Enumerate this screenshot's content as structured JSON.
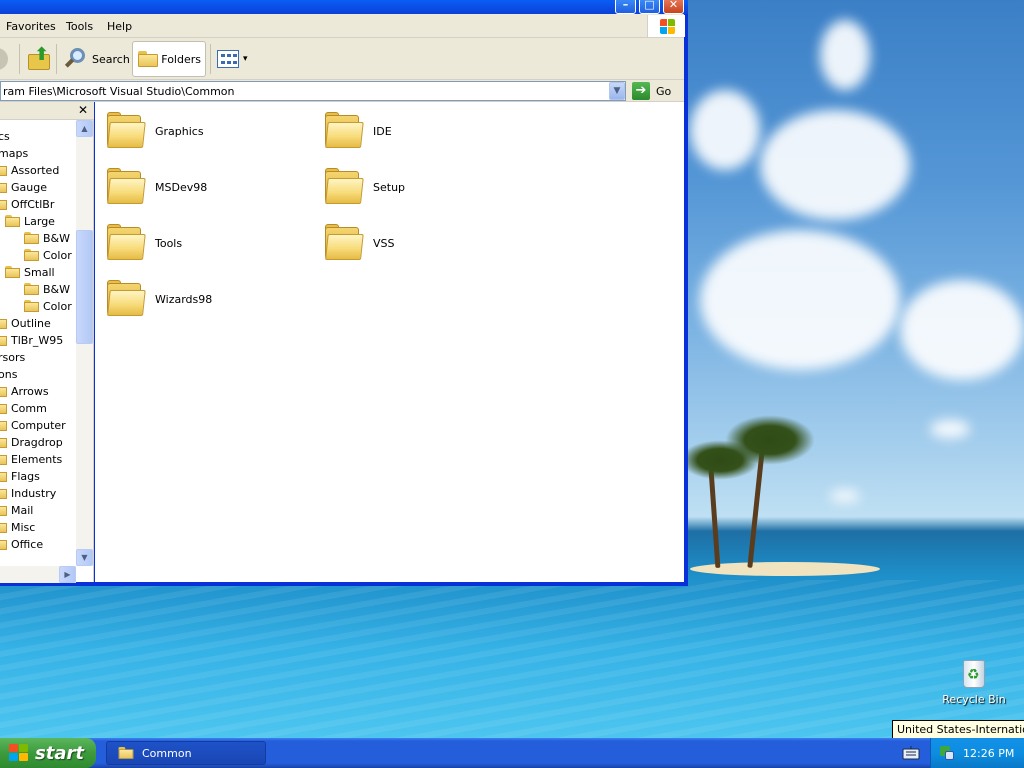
{
  "window": {
    "title_buttons": {
      "minimize": "–",
      "maximize": "□",
      "close": "✕"
    },
    "menu": [
      "Favorites",
      "Tools",
      "Help"
    ],
    "toolbar": {
      "up_label": "",
      "search_label": "Search",
      "folders_label": "Folders",
      "views_dropdown": "▾"
    },
    "address": {
      "value": "ram Files\\Microsoft Visual Studio\\Common",
      "go_label": "Go"
    },
    "folders_pane": {
      "close_label": "✕",
      "tree": [
        {
          "label": "cs",
          "folder": false
        },
        {
          "label": "maps",
          "folder": false
        },
        {
          "label": "Assorted",
          "folder": true
        },
        {
          "label": "Gauge",
          "folder": true
        },
        {
          "label": "OffCtlBr",
          "folder": true
        },
        {
          "label": "Large",
          "folder": true
        },
        {
          "label": "B&W",
          "folder": true
        },
        {
          "label": "Color",
          "folder": true
        },
        {
          "label": "Small",
          "folder": true
        },
        {
          "label": "B&W",
          "folder": true
        },
        {
          "label": "Color",
          "folder": true
        },
        {
          "label": "Outline",
          "folder": true
        },
        {
          "label": "TlBr_W95",
          "folder": true
        },
        {
          "label": "rsors",
          "folder": false
        },
        {
          "label": "ons",
          "folder": false
        },
        {
          "label": "Arrows",
          "folder": true
        },
        {
          "label": "Comm",
          "folder": true
        },
        {
          "label": "Computer",
          "folder": true
        },
        {
          "label": "Dragdrop",
          "folder": true
        },
        {
          "label": "Elements",
          "folder": true
        },
        {
          "label": "Flags",
          "folder": true
        },
        {
          "label": "Industry",
          "folder": true
        },
        {
          "label": "Mail",
          "folder": true
        },
        {
          "label": "Misc",
          "folder": true
        },
        {
          "label": "Office",
          "folder": true
        }
      ]
    },
    "content": {
      "folders": [
        "Graphics",
        "IDE",
        "MSDev98",
        "Setup",
        "Tools",
        "VSS",
        "Wizards98"
      ]
    }
  },
  "desktop": {
    "recycle_bin_label": "Recycle Bin",
    "tooltip": "United States-International"
  },
  "taskbar": {
    "start_label": "start",
    "task_label": "Common",
    "clock": "12:26 PM"
  },
  "colors": {
    "taskbar_blue": "#245edb",
    "start_green": "#3c9a3c",
    "window_frame": "#0831d9",
    "chrome": "#ece9d8"
  }
}
